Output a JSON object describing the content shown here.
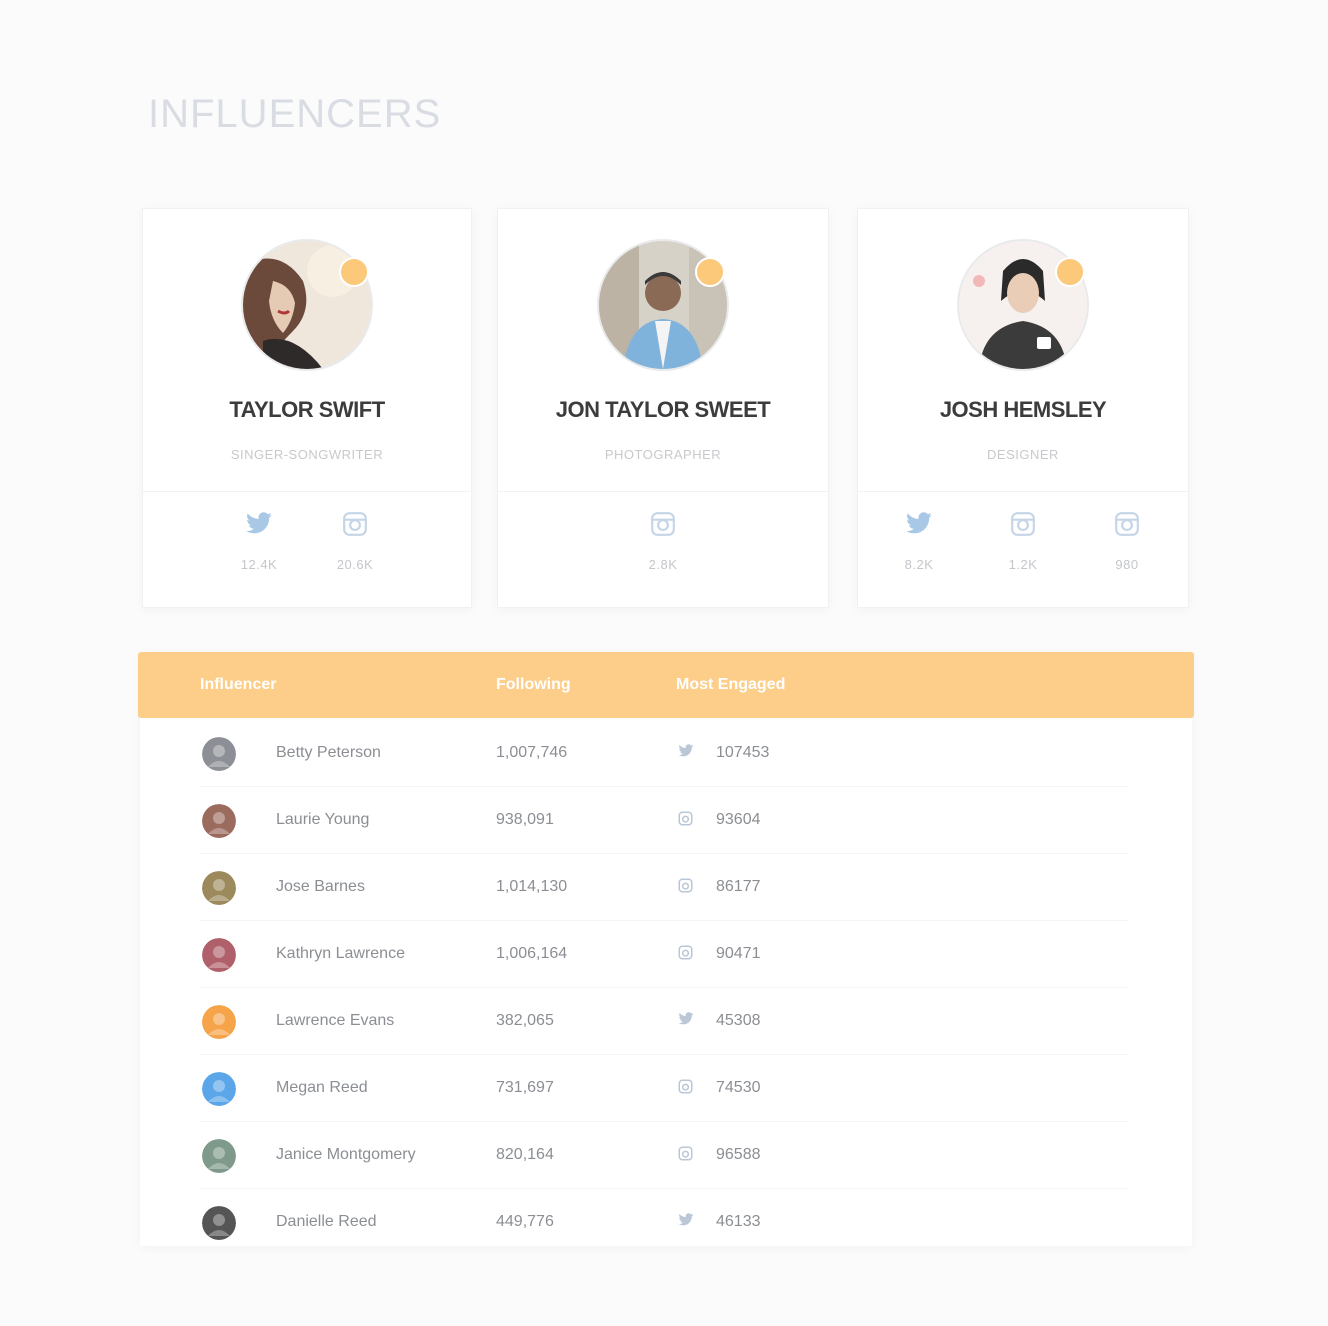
{
  "page": {
    "title": "INFLUENCERS"
  },
  "colors": {
    "accent": "#fdce8a",
    "verified": "#fcc97a",
    "twitter": "#a9c8e6",
    "instagram": "#c5d5e8"
  },
  "cards": [
    {
      "name": "TAYLOR SWIFT",
      "role": "SINGER-SONGWRITER",
      "social": [
        {
          "icon": "twitter-icon",
          "count": "12.4K"
        },
        {
          "icon": "instagram-icon",
          "count": "20.6K"
        }
      ]
    },
    {
      "name": "JON TAYLOR SWEET",
      "role": "PHOTOGRAPHER",
      "social": [
        {
          "icon": "instagram-icon",
          "count": "2.8K"
        }
      ]
    },
    {
      "name": "JOSH HEMSLEY",
      "role": "DESIGNER",
      "social": [
        {
          "icon": "twitter-icon",
          "count": "8.2K"
        },
        {
          "icon": "instagram-icon",
          "count": "1.2K"
        },
        {
          "icon": "instagram-icon",
          "count": "980"
        }
      ]
    }
  ],
  "table": {
    "headers": [
      "Influencer",
      "Following",
      "Most Engaged"
    ],
    "rows": [
      {
        "name": "Betty Peterson",
        "following": "1,007,746",
        "network_icon": "twitter-icon",
        "engaged": "107453",
        "avatar_color": "#8d8f96"
      },
      {
        "name": "Laurie Young",
        "following": "938,091",
        "network_icon": "instagram-icon",
        "engaged": "93604",
        "avatar_color": "#9b6b5e"
      },
      {
        "name": "Jose Barnes",
        "following": "1,014,130",
        "network_icon": "instagram-icon",
        "engaged": "86177",
        "avatar_color": "#9c8a5c"
      },
      {
        "name": "Kathryn Lawrence",
        "following": "1,006,164",
        "network_icon": "instagram-icon",
        "engaged": "90471",
        "avatar_color": "#b0606a"
      },
      {
        "name": "Lawrence Evans",
        "following": "382,065",
        "network_icon": "twitter-icon",
        "engaged": "45308",
        "avatar_color": "#f6a44a"
      },
      {
        "name": "Megan Reed",
        "following": "731,697",
        "network_icon": "instagram-icon",
        "engaged": "74530",
        "avatar_color": "#5aa6e8"
      },
      {
        "name": "Janice Montgomery",
        "following": "820,164",
        "network_icon": "instagram-icon",
        "engaged": "96588",
        "avatar_color": "#7f9a8a"
      },
      {
        "name": "Danielle Reed",
        "following": "449,776",
        "network_icon": "twitter-icon",
        "engaged": "46133",
        "avatar_color": "#555555"
      }
    ]
  }
}
